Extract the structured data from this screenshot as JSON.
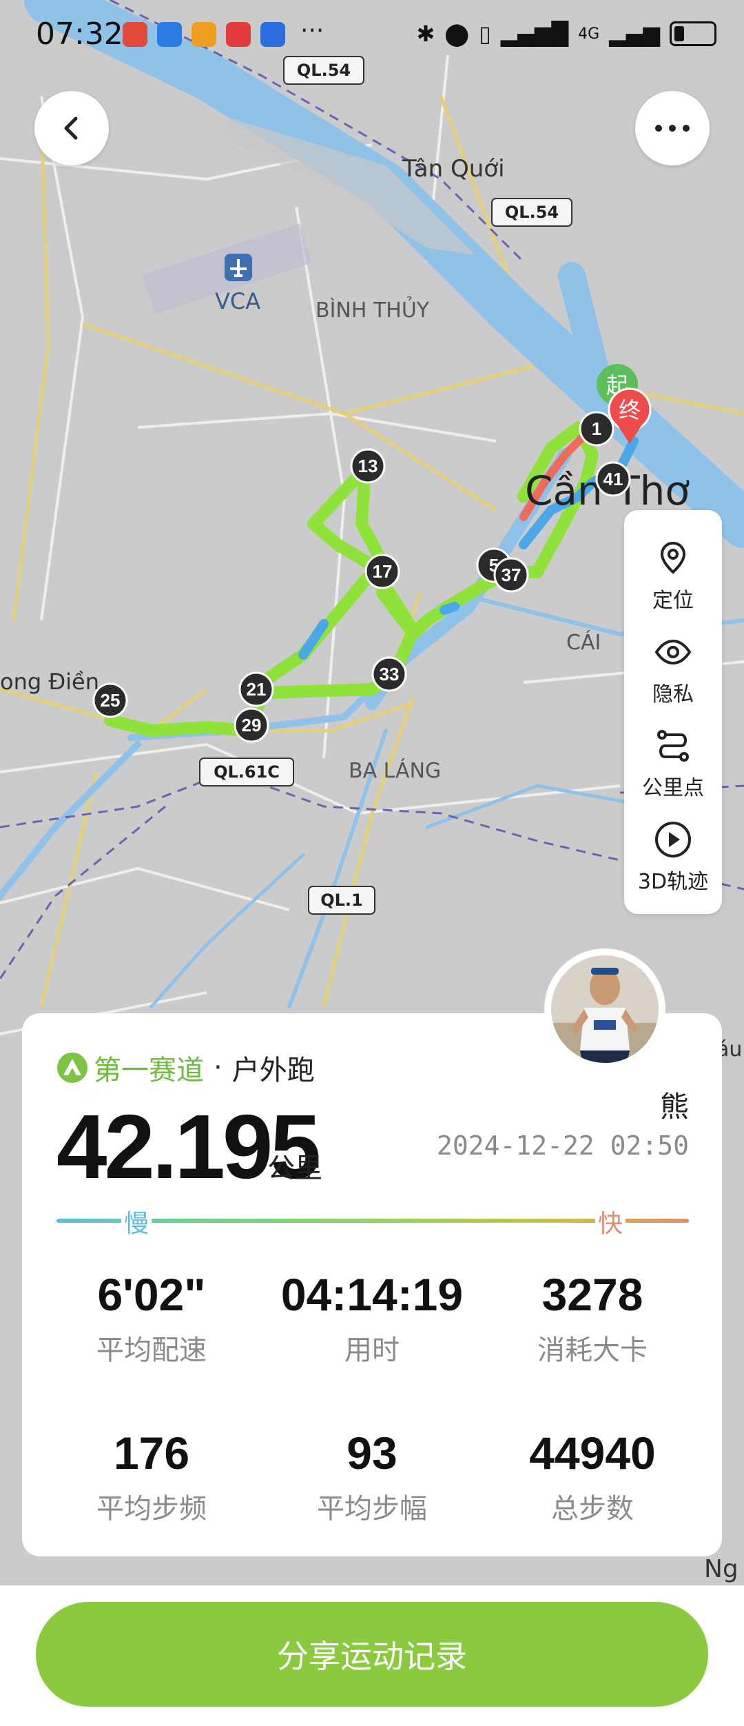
{
  "status_bar": {
    "time": "07:32",
    "more": "···",
    "network": "4G",
    "app_icon_colors": [
      "#e04a3a",
      "#2a7be4",
      "#f0a020",
      "#e33b3b",
      "#2a6ee0"
    ]
  },
  "map": {
    "labels": {
      "ql54_top": "QL.54",
      "tan_quoi": "Tân Quới",
      "ql54_mid": "QL.54",
      "vca": "VCA",
      "binh_thuy": "BÌNH THỦY",
      "can_tho": "Cần Thơ",
      "cai": "CÁI",
      "ong_dien": "ong Điền",
      "ql61c": "QL.61C",
      "ba_lang": "BA LÁNG",
      "ql1": "QL.1",
      "edge_right": "áu",
      "edge_bottom": "Ng"
    },
    "start_marker": "起",
    "end_marker": "终",
    "km_markers": [
      "1",
      "13",
      "17",
      "5",
      "37",
      "41",
      "21",
      "25",
      "29",
      "33"
    ]
  },
  "toolbar": {
    "locate": "定位",
    "privacy": "隐私",
    "km_points": "公里点",
    "track_3d": "3D轨迹"
  },
  "summary": {
    "brand": "第一赛道",
    "separator": "·",
    "activity_type": "户外跑",
    "distance": "42.195",
    "distance_unit": "公里",
    "user_name": "熊",
    "datetime": "2024-12-22 02:50",
    "pace_slow": "慢",
    "pace_fast": "快",
    "stats": [
      {
        "value": "6'02\"",
        "label": "平均配速"
      },
      {
        "value": "04:14:19",
        "label": "用时"
      },
      {
        "value": "3278",
        "label": "消耗大卡"
      },
      {
        "value": "176",
        "label": "平均步频"
      },
      {
        "value": "93",
        "label": "平均步幅"
      },
      {
        "value": "44940",
        "label": "总步数"
      }
    ]
  },
  "share_button": "分享运动记录",
  "colors": {
    "accent": "#8bc93f",
    "route_green": "#8fe23a",
    "route_blue": "#4aa8e8",
    "route_red": "#ef6a5a"
  }
}
